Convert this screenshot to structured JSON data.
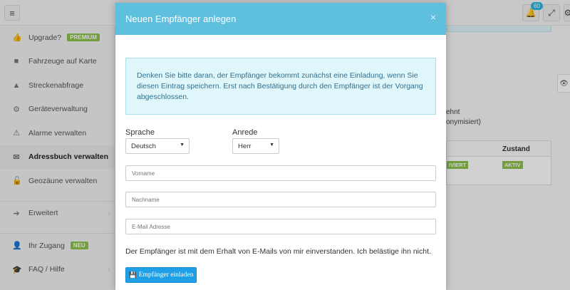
{
  "topbar": {
    "menu_icon": "hamburger-icon",
    "notification_count": "60",
    "bell_icon": "bell-icon",
    "fullscreen_icon": "expand-icon"
  },
  "sidebar": {
    "items": [
      {
        "label": "Upgrade?",
        "icon": "thumbs-up-icon",
        "badge": "PREMIUM"
      },
      {
        "label": "Fahrzeuge auf Karte",
        "icon": "truck-icon"
      },
      {
        "label": "Streckenabfrage",
        "icon": "road-icon"
      },
      {
        "label": "Geräteverwaltung",
        "icon": "gears-icon"
      },
      {
        "label": "Alarme verwalten",
        "icon": "warning-icon"
      },
      {
        "label": "Adressbuch verwalten",
        "icon": "envelope-icon",
        "active": true
      },
      {
        "label": "Geozäune verwalten",
        "icon": "unlock-icon"
      },
      {
        "label": "Erweitert",
        "icon": "arrow-right-icon"
      },
      {
        "label": "Ihr Zugang",
        "icon": "user-icon",
        "badge": "NEU"
      },
      {
        "label": "FAQ / Hilfe",
        "icon": "graduation-cap-icon"
      }
    ]
  },
  "background": {
    "text_line1": "ehnt",
    "text_line2": "onymisiert)",
    "table_header": "Zustand",
    "tag_left": "IVIERT",
    "tag_right": "AKTIV"
  },
  "modal": {
    "title": "Neuen Empfänger anlegen",
    "close": "×",
    "alert_text": "Denken Sie bitte daran, der Empfänger bekommt zunächst eine Einladung, wenn Sie diesen Eintrag speichern. Erst nach Bestätigung durch den Empfänger ist der Vorgang abgeschlossen.",
    "language_label": "Sprache",
    "language_value": "Deutsch",
    "salutation_label": "Anrede",
    "salutation_value": "Herr",
    "firstname_placeholder": "Vorname",
    "lastname_placeholder": "Nachname",
    "email_placeholder": "E-Mail Adresse",
    "consent_text": "Der Empfänger ist mit dem Erhalt von E-Mails von mir einverstanden. Ich belästige ihn nicht.",
    "invite_button": "Empfänger einladen"
  },
  "colors": {
    "header": "#5ec0dd",
    "button": "#1e9fe6",
    "badge_green": "#8bc34a",
    "alert_bg": "#dff6fa"
  }
}
